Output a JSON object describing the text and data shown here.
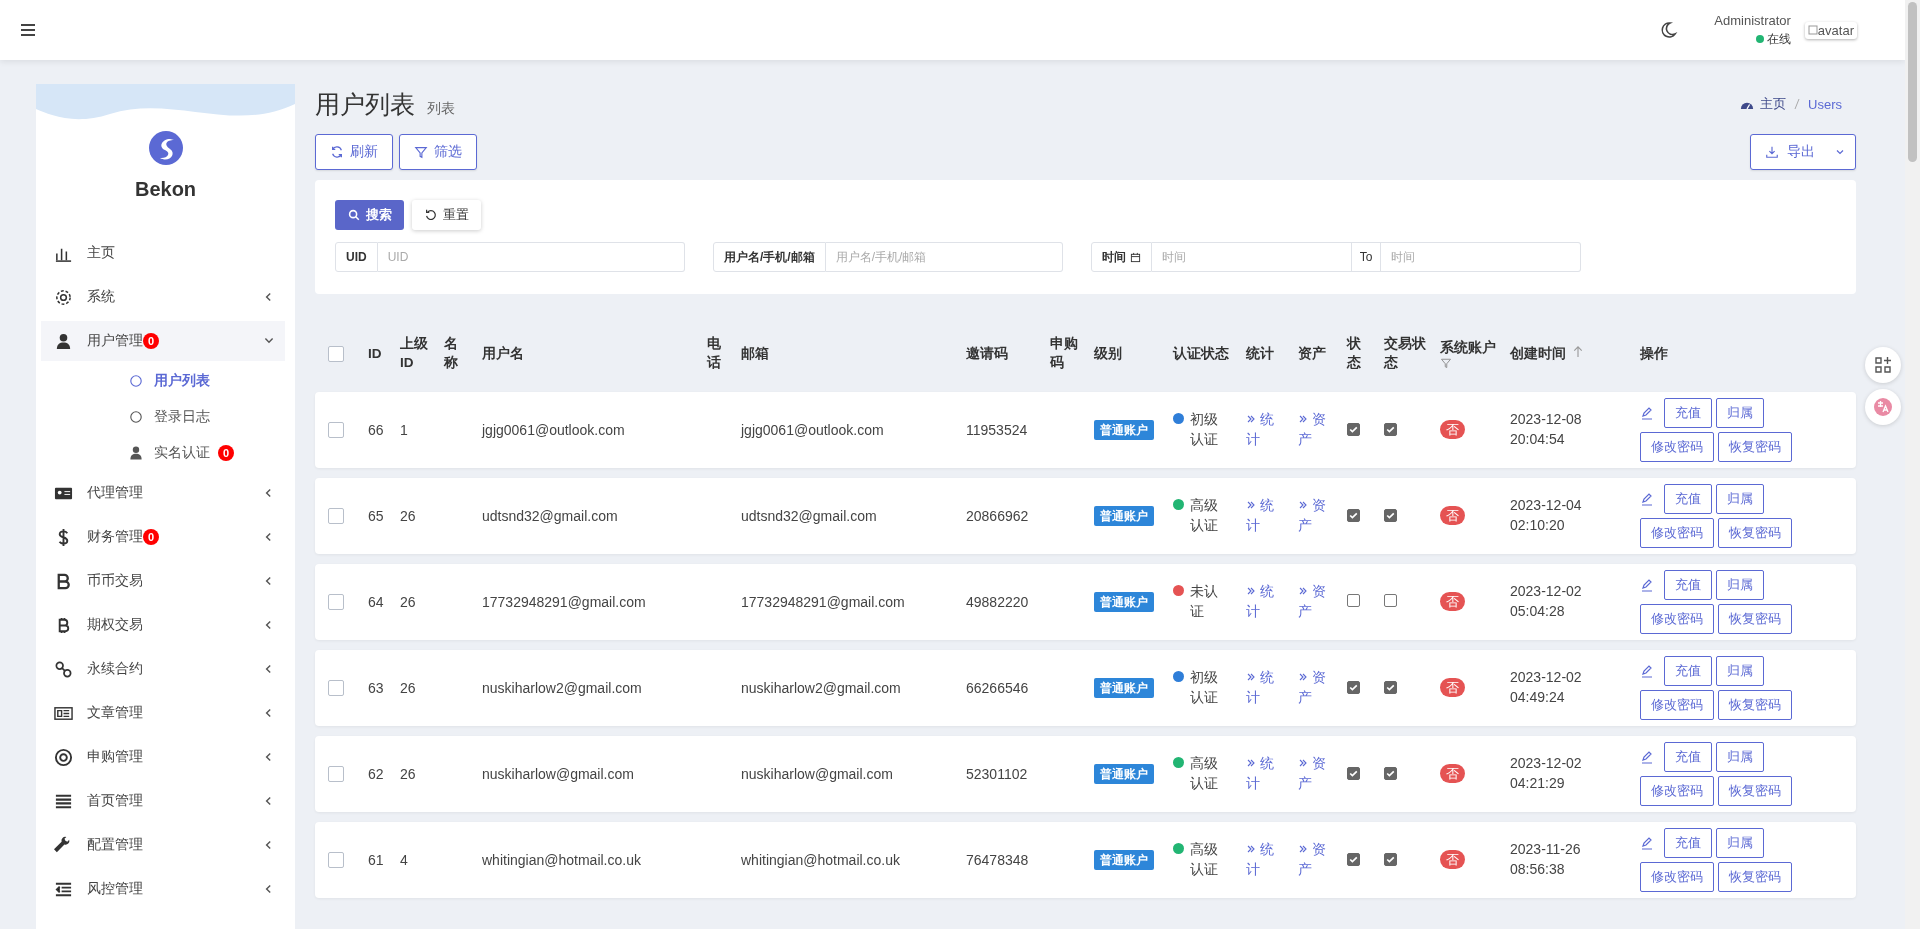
{
  "topbar": {
    "user_name": "Administrator",
    "status": "在线",
    "avatar_alt": "avatar"
  },
  "sidebar": {
    "brand": "Bekon",
    "items": [
      {
        "label": "主页"
      },
      {
        "label": "系统",
        "expanded": false
      },
      {
        "label": "用户管理",
        "badge": "0",
        "expanded": true,
        "children": [
          {
            "label": "用户列表",
            "selected": true
          },
          {
            "label": "登录日志",
            "selected": false
          },
          {
            "label": "实名认证",
            "badge": "0",
            "selected": false
          }
        ]
      },
      {
        "label": "代理管理",
        "expanded": false
      },
      {
        "label": "财务管理",
        "badge": "0",
        "expanded": false
      },
      {
        "label": "币币交易",
        "expanded": false
      },
      {
        "label": "期权交易",
        "expanded": false
      },
      {
        "label": "永续合约",
        "expanded": false
      },
      {
        "label": "文章管理",
        "expanded": false
      },
      {
        "label": "申购管理",
        "expanded": false
      },
      {
        "label": "首页管理",
        "expanded": false
      },
      {
        "label": "配置管理",
        "expanded": false
      },
      {
        "label": "风控管理",
        "expanded": false
      }
    ]
  },
  "page": {
    "title": "用户列表",
    "subtitle": "列表",
    "breadcrumb": [
      "主页",
      "Users"
    ],
    "toolbar": [
      "刷新",
      "筛选"
    ],
    "export": "导出"
  },
  "filter": {
    "search": "搜索",
    "reset": "重置",
    "fields": [
      {
        "kind": "text",
        "label": "UID",
        "placeholder": "UID"
      },
      {
        "kind": "text",
        "label": "用户名/手机/邮箱",
        "placeholder": "用户名/手机/邮箱"
      },
      {
        "kind": "range",
        "label": "时间",
        "placeholder": "时间",
        "to": "To",
        "placeholder_end": "时间"
      }
    ]
  },
  "table": {
    "select_all": false,
    "columns": [
      "ID",
      "上级ID",
      "名称",
      "用户名",
      "电话",
      "邮箱",
      "邀请码",
      "申购码",
      "级别",
      "认证状态",
      "统计",
      "资产",
      "状态",
      "交易状态",
      "系统账户",
      "创建时间",
      "操作"
    ],
    "rows": [
      {
        "selected": false,
        "id": "66",
        "parent_id": "1",
        "username": "jgjg0061@outlook.com",
        "email": "jgjg0061@outlook.com",
        "invite_code": "11953524",
        "level": "普通账户",
        "verification": {
          "label": "初级认证",
          "color": "#2f7ed8"
        },
        "stats": "统计",
        "assets": "资产",
        "status_on": true,
        "trade_on": true,
        "system": "否",
        "created": "2023-12-08 20:04:54",
        "actions": [
          "充值",
          "归属",
          "修改密码",
          "恢复密码"
        ]
      },
      {
        "selected": false,
        "id": "65",
        "parent_id": "26",
        "username": "udtsnd32@gmail.com",
        "email": "udtsnd32@gmail.com",
        "invite_code": "20866962",
        "level": "普通账户",
        "verification": {
          "label": "高级认证",
          "color": "#22b573"
        },
        "stats": "统计",
        "assets": "资产",
        "status_on": true,
        "trade_on": true,
        "system": "否",
        "created": "2023-12-04 02:10:20",
        "actions": [
          "充值",
          "归属",
          "修改密码",
          "恢复密码"
        ]
      },
      {
        "selected": false,
        "id": "64",
        "parent_id": "26",
        "username": "17732948291@gmail.com",
        "email": "17732948291@gmail.com",
        "invite_code": "49882220",
        "level": "普通账户",
        "verification": {
          "label": "未认证",
          "color": "#e55353"
        },
        "stats": "统计",
        "assets": "资产",
        "status_on": false,
        "trade_on": false,
        "system": "否",
        "created": "2023-12-02 05:04:28",
        "actions": [
          "充值",
          "归属",
          "修改密码",
          "恢复密码"
        ]
      },
      {
        "selected": false,
        "id": "63",
        "parent_id": "26",
        "username": "nuskiharlow2@gmail.com",
        "email": "nuskiharlow2@gmail.com",
        "invite_code": "66266546",
        "level": "普通账户",
        "verification": {
          "label": "初级认证",
          "color": "#2f7ed8"
        },
        "stats": "统计",
        "assets": "资产",
        "status_on": true,
        "trade_on": true,
        "system": "否",
        "created": "2023-12-02 04:49:24",
        "actions": [
          "充值",
          "归属",
          "修改密码",
          "恢复密码"
        ]
      },
      {
        "selected": false,
        "id": "62",
        "parent_id": "26",
        "username": "nuskiharlow@gmail.com",
        "email": "nuskiharlow@gmail.com",
        "invite_code": "52301102",
        "level": "普通账户",
        "verification": {
          "label": "高级认证",
          "color": "#22b573"
        },
        "stats": "统计",
        "assets": "资产",
        "status_on": true,
        "trade_on": true,
        "system": "否",
        "created": "2023-12-02 04:21:29",
        "actions": [
          "充值",
          "归属",
          "修改密码",
          "恢复密码"
        ]
      },
      {
        "selected": false,
        "id": "61",
        "parent_id": "4",
        "username": "whitingian@hotmail.co.uk",
        "email": "whitingian@hotmail.co.uk",
        "invite_code": "76478348",
        "level": "普通账户",
        "verification": {
          "label": "高级认证",
          "color": "#22b573"
        },
        "stats": "统计",
        "assets": "资产",
        "status_on": true,
        "trade_on": true,
        "system": "否",
        "created": "2023-11-26 08:56:38",
        "actions": [
          "充值",
          "归属",
          "修改密码",
          "恢复密码"
        ]
      }
    ]
  }
}
